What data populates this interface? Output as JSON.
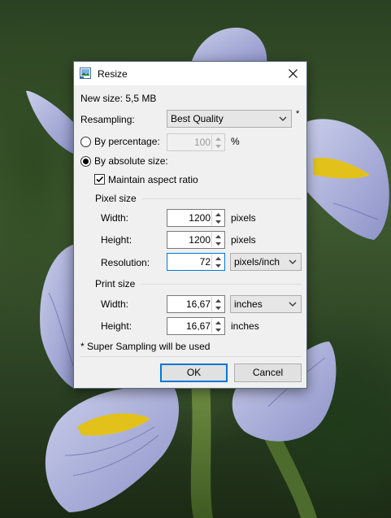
{
  "dialog": {
    "title": "Resize",
    "new_size": "New size: 5,5 MB",
    "resampling_label": "Resampling:",
    "resampling_value": "Best Quality",
    "resampling_marker": "*",
    "by_percentage_label": "By percentage:",
    "percentage_value": "100",
    "percent_unit": "%",
    "by_absolute_label": "By absolute size:",
    "maintain_aspect_label": "Maintain aspect ratio",
    "pixel_size": {
      "title": "Pixel size",
      "width_label": "Width:",
      "width_value": "1200",
      "width_unit": "pixels",
      "height_label": "Height:",
      "height_value": "1200",
      "height_unit": "pixels",
      "resolution_label": "Resolution:",
      "resolution_value": "72",
      "resolution_unit": "pixels/inch"
    },
    "print_size": {
      "title": "Print size",
      "width_label": "Width:",
      "width_value": "16,67",
      "width_unit": "inches",
      "height_label": "Height:",
      "height_value": "16,67",
      "height_unit": "inches"
    },
    "footnote": "* Super Sampling will be used",
    "ok_label": "OK",
    "cancel_label": "Cancel"
  },
  "state": {
    "by_percentage_selected": false,
    "by_absolute_selected": true,
    "maintain_aspect_checked": true
  },
  "colors": {
    "accent": "#0078d7",
    "dialog_bg": "#f0f0f0"
  }
}
